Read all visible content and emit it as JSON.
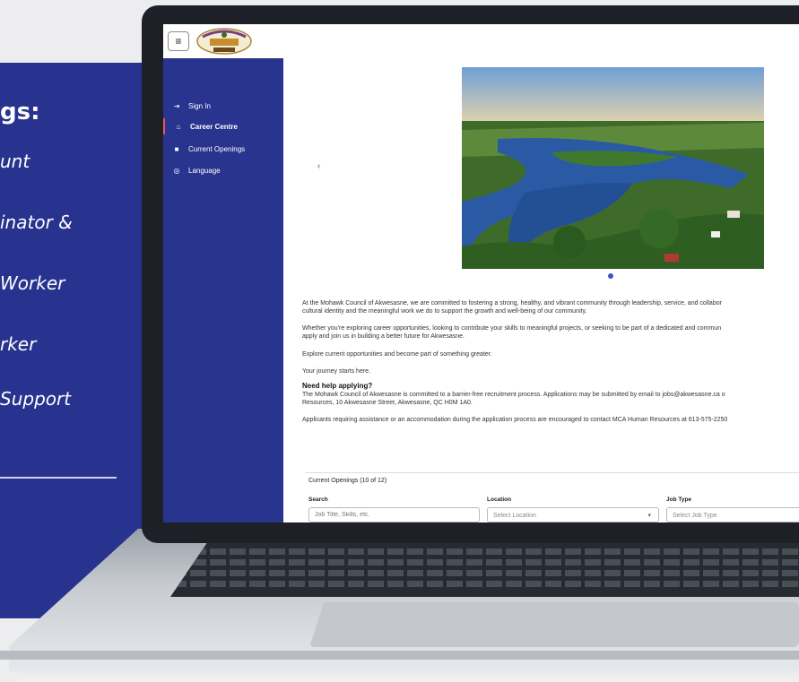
{
  "promo": {
    "heading": "gs:",
    "lines": [
      "unt",
      "inator &",
      "Worker",
      "rker",
      "Support"
    ]
  },
  "app": {
    "menu_icon": "hamburger-icon"
  },
  "sidebar": {
    "items": [
      {
        "label": "Sign In",
        "icon": "sign-in-icon"
      },
      {
        "label": "Career Centre",
        "icon": "home-icon"
      },
      {
        "label": "Current Openings",
        "icon": "briefcase-icon"
      },
      {
        "label": "Language",
        "icon": "globe-icon"
      }
    ]
  },
  "carousel": {
    "prev_label": "‹"
  },
  "content": {
    "p1a": "At the Mohawk Council of Akwesasne, we are committed to fostering a strong, healthy, and vibrant community through leadership, service, and collabor",
    "p1b": "cultural identity and the meaningful work we do to support the growth and well-being of our community.",
    "p2a": "Whether you're exploring career opportunities, looking to contribute your skills to meaningful projects, or seeking to be part of a dedicated and commun",
    "p2b": "apply and join us in building a better future for Akwesasne.",
    "p3": "Explore current opportunities and become part of something greater.",
    "p4": "Your journey starts here.",
    "help_heading": "Need help applying?",
    "p5a": "The Mohawk Council of Akwesasne is committed to a barrier-free recruitment process. Applications may be submitted by email to jobs@akwesasne.ca o",
    "p5b": "Resources, 10 Akwesasne Street, Akwesasne, QC H0M 1A0.",
    "p6": "Applicants requiring assistance or an accommodation during the application process are encouraged to contact MCA Human Resources at 613-575-2250"
  },
  "openings": {
    "title": "Current Openings (10 of 12)",
    "search_label": "Search",
    "search_placeholder": "Job Title, Skills, etc.",
    "location_label": "Location",
    "location_value": "Select Location",
    "jobtype_label": "Job Type",
    "jobtype_value": "Select Job Type"
  },
  "colors": {
    "sidebar": "#29348f",
    "promo": "#27338f",
    "accent": "#3b55c9"
  }
}
